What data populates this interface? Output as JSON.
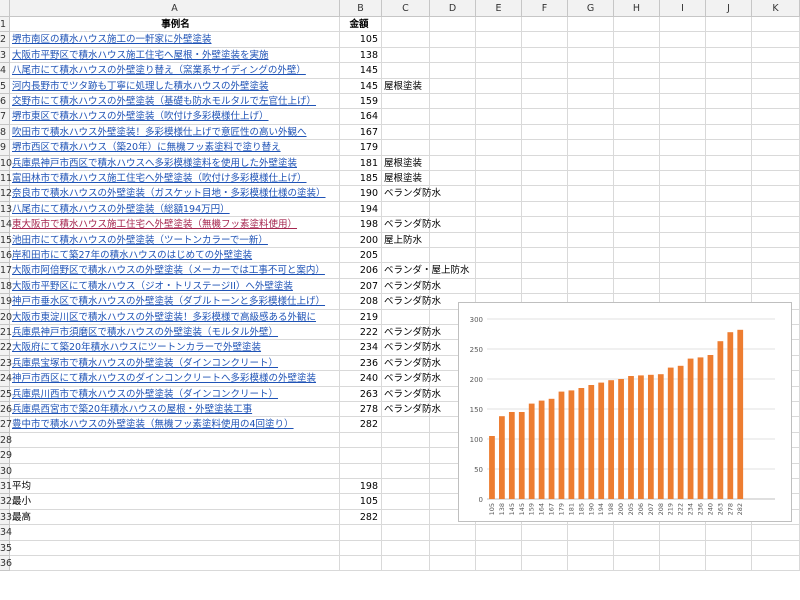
{
  "columns": [
    "A",
    "B",
    "C",
    "D",
    "E",
    "F",
    "G",
    "H",
    "I",
    "J",
    "K"
  ],
  "header_row": {
    "a": "事例名",
    "b": "金額"
  },
  "rows": [
    {
      "n": "2",
      "a": "堺市南区の積水ハウス施工の一軒家に外壁塗装",
      "b": "105",
      "c": ""
    },
    {
      "n": "3",
      "a": "大阪市平野区で積水ハウス施工住宅へ屋根・外壁塗装を実施",
      "b": "138",
      "c": ""
    },
    {
      "n": "4",
      "a": "八尾市にて積水ハウスの外壁塗り替え（窯業系サイディングの外壁）",
      "b": "145",
      "c": ""
    },
    {
      "n": "5",
      "a": "河内長野市でツタ跡も丁寧に処理した積水ハウスの外壁塗装",
      "b": "145",
      "c": "屋根塗装"
    },
    {
      "n": "6",
      "a": "交野市にて積水ハウスの外壁塗装（基礎も防水モルタルで左官仕上げ）",
      "b": "159",
      "c": ""
    },
    {
      "n": "7",
      "a": "堺市東区で積水ハウスの外壁塗装（吹付け多彩模様仕上げ）",
      "b": "164",
      "c": ""
    },
    {
      "n": "8",
      "a": "吹田市で積水ハウス外壁塗装！多彩模様仕上げで意匠性の高い外観へ",
      "b": "167",
      "c": ""
    },
    {
      "n": "9",
      "a": "堺市西区で積水ハウス（築20年）に無機フッ素塗料で塗り替え",
      "b": "179",
      "c": ""
    },
    {
      "n": "10",
      "a": "兵庫県神戸市西区で積水ハウスへ多彩模様塗料を使用した外壁塗装",
      "b": "181",
      "c": "屋根塗装"
    },
    {
      "n": "11",
      "a": "富田林市で積水ハウス施工住宅へ外壁塗装（吹付け多彩模様仕上げ）",
      "b": "185",
      "c": "屋根塗装"
    },
    {
      "n": "12",
      "a": "奈良市で積水ハウスの外壁塗装（ガスケット目地・多彩模様仕様の塗装）",
      "b": "190",
      "c": "ベランダ防水"
    },
    {
      "n": "13",
      "a": "八尾市にて積水ハウスの外壁塗装（総額194万円）",
      "b": "194",
      "c": ""
    },
    {
      "n": "14",
      "a": "東大阪市で積水ハウス施工住宅へ外壁塗装（無機フッ素塗料使用）",
      "b": "198",
      "c": "ベランダ防水"
    },
    {
      "n": "15",
      "a": "池田市にて積水ハウスの外壁塗装（ツートンカラーで一新）",
      "b": "200",
      "c": "屋上防水"
    },
    {
      "n": "16",
      "a": "岸和田市にて築27年の積水ハウスのはじめての外壁塗装",
      "b": "205",
      "c": ""
    },
    {
      "n": "17",
      "a": "大阪市阿倍野区で積水ハウスの外壁塗装（メーカーでは工事不可と案内）",
      "b": "206",
      "c": "ベランダ・屋上防水"
    },
    {
      "n": "18",
      "a": "大阪市平野区にて積水ハウス（ジオ・トリステージII）へ外壁塗装",
      "b": "207",
      "c": "ベランダ防水"
    },
    {
      "n": "19",
      "a": "神戸市垂水区で積水ハウスの外壁塗装（ダブルトーンと多彩模様仕上げ）",
      "b": "208",
      "c": "ベランダ防水"
    },
    {
      "n": "20",
      "a": "大阪市東淀川区で積水ハウスの外壁塗装！多彩模様で高級感ある外観に",
      "b": "219",
      "c": ""
    },
    {
      "n": "21",
      "a": "兵庫県神戸市須磨区で積水ハウスの外壁塗装（モルタル外壁）",
      "b": "222",
      "c": "ベランダ防水"
    },
    {
      "n": "22",
      "a": "大阪府にて築20年積水ハウスにツートンカラーで外壁塗装",
      "b": "234",
      "c": "ベランダ防水"
    },
    {
      "n": "23",
      "a": "兵庫県宝塚市で積水ハウスの外壁塗装（ダインコンクリート）",
      "b": "236",
      "c": "ベランダ防水"
    },
    {
      "n": "24",
      "a": "神戸市西区にて積水ハウスのダインコンクリートへ多彩模様の外壁塗装",
      "b": "240",
      "c": "ベランダ防水"
    },
    {
      "n": "25",
      "a": "兵庫県川西市で積水ハウスの外壁塗装（ダインコンクリート）",
      "b": "263",
      "c": "ベランダ防水"
    },
    {
      "n": "26",
      "a": "兵庫県西宮市で築20年積水ハウスの屋根・外壁塗装工事",
      "b": "278",
      "c": "ベランダ防水"
    },
    {
      "n": "27",
      "a": "豊中市で積水ハウスの外壁塗装（無機フッ素塗料使用の4回塗り）",
      "b": "282",
      "c": ""
    },
    {
      "n": "28",
      "a": "",
      "b": "",
      "c": ""
    },
    {
      "n": "29",
      "a": "",
      "b": "",
      "c": ""
    },
    {
      "n": "30",
      "a": "",
      "b": "",
      "c": ""
    },
    {
      "n": "31",
      "a": "平均",
      "b": "198",
      "c": ""
    },
    {
      "n": "32",
      "a": "最小",
      "b": "105",
      "c": ""
    },
    {
      "n": "33",
      "a": "最高",
      "b": "282",
      "c": ""
    },
    {
      "n": "34",
      "a": "",
      "b": "",
      "c": ""
    },
    {
      "n": "35",
      "a": "",
      "b": "",
      "c": ""
    },
    {
      "n": "36",
      "a": "",
      "b": "",
      "c": ""
    }
  ],
  "chart_data": {
    "type": "bar",
    "categories": [
      "105",
      "138",
      "145",
      "145",
      "159",
      "164",
      "167",
      "179",
      "181",
      "185",
      "190",
      "194",
      "198",
      "200",
      "205",
      "206",
      "207",
      "208",
      "219",
      "222",
      "234",
      "236",
      "240",
      "263",
      "278",
      "282"
    ],
    "values": [
      105,
      138,
      145,
      145,
      159,
      164,
      167,
      179,
      181,
      185,
      190,
      194,
      198,
      200,
      205,
      206,
      207,
      208,
      219,
      222,
      234,
      236,
      240,
      263,
      278,
      282
    ],
    "title": "",
    "xlabel": "",
    "ylabel": "",
    "ylim": [
      0,
      300
    ],
    "yticks": [
      "0",
      "50",
      "100",
      "150",
      "200",
      "250",
      "300"
    ],
    "grid": true,
    "bar_color": "#ed7d31",
    "legend": "none"
  }
}
